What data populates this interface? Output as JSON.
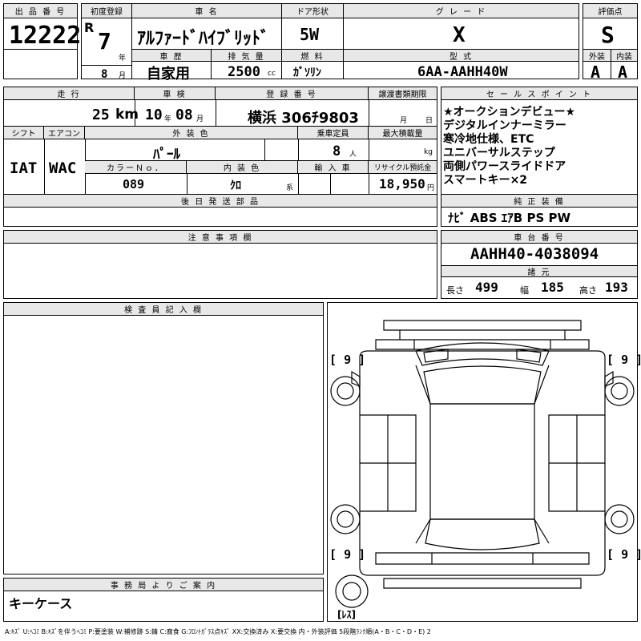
{
  "header": {
    "lot_label": "出 品 番 号",
    "lot_number": "12222",
    "first_reg_label": "初度登録",
    "era": "R",
    "year": "7",
    "year_unit": "年",
    "month": "8",
    "month_unit": "月",
    "name_label": "車 名",
    "car_name": "ｱﾙﾌｧｰﾄﾞﾊｲﾌﾞﾘｯﾄﾞ",
    "door_label": "ドア形状",
    "door": "5W",
    "grade_label": "グ レ ー ド",
    "grade": "X",
    "score_label": "評価点",
    "score": "S",
    "history_label": "車 歴",
    "history": "自家用",
    "displacement_label": "排 気 量",
    "displacement": "2500",
    "displacement_unit": "cc",
    "fuel_label": "燃 料",
    "fuel": "ｶﾞｿﾘﾝ",
    "model_label": "型 式",
    "model": "6AA-AAHH40W",
    "exterior_label": "外装",
    "exterior": "A",
    "interior_label": "内装",
    "interior": "A"
  },
  "info": {
    "mileage_label": "走 行",
    "mileage": "25",
    "mileage_unit": "km",
    "inspection_label": "車 検",
    "inspection_year": "10",
    "inspection_year_unit": "年",
    "inspection_month": "08",
    "inspection_month_unit": "月",
    "reg_label": "登 録 番 号",
    "reg_number": "横浜 306ﾁ9803",
    "transfer_label": "譲渡書類期限",
    "transfer_month_unit": "月",
    "transfer_day_unit": "日",
    "shift_label": "シフト",
    "shift": "IAT",
    "ac_label": "エアコン",
    "ac": "WAC",
    "color_label": "外 装 色",
    "color": "ﾊﾟｰﾙ",
    "capacity_label": "乗車定員",
    "capacity": "8",
    "capacity_unit": "人",
    "load_label": "最大積載量",
    "load_unit": "kg",
    "color_no_label": "カラーＮｏ．",
    "color_no": "089",
    "int_color_label": "内 装 色",
    "int_color": "ｸﾛ",
    "int_color_unit": "系",
    "import_label": "輸 入 車",
    "recycle_label": "リサイクル預託金",
    "recycle": "18,950",
    "recycle_unit": "円",
    "later_parts_label": "後 日 発 送 部 品",
    "notes_label": "注 意 事 項 欄",
    "inspector_label": "検 査 員 記 入 欄",
    "office_label": "事 務 局 よ り ご 案 内",
    "office_text": "キーケース"
  },
  "sales": {
    "label": "セ ー ル ス ポ イ ン ト",
    "lines": [
      "★オークションデビュー★",
      "デジタルインナーミラー",
      "寒冷地仕様、ETC",
      "ユニバーサルステップ",
      "両側パワースライドドア",
      "スマートキー×2"
    ]
  },
  "equipment": {
    "label": "純 正 装 備",
    "value": "ﾅﾋﾞ ABS ｴｱB PS PW"
  },
  "chassis": {
    "label": "車 台 番 号",
    "value": "AAHH40-4038094",
    "specs_label": "諸 元",
    "length_label": "長さ",
    "length": "499",
    "width_label": "幅",
    "width": "185",
    "height_label": "高さ",
    "height": "193"
  },
  "diagram": {
    "tire_fl": "9",
    "tire_fr": "9",
    "tire_rl": "9",
    "tire_rr": "9",
    "spare": "ﾚｽ"
  },
  "legend": "A:ｷｽﾞ U:ﾍｺﾐ B:ｷｽﾞを伴うﾍｺﾐ P:要塗装 W:補修跡 S:錆 C:腐食 G:ﾌﾛﾝﾄｶﾞﾗｽ点ｷｽﾞ XX:交換済み X:要交換 内・外装評価 5段階ﾗﾝｸ順(A・B・C・D・E) 2"
}
